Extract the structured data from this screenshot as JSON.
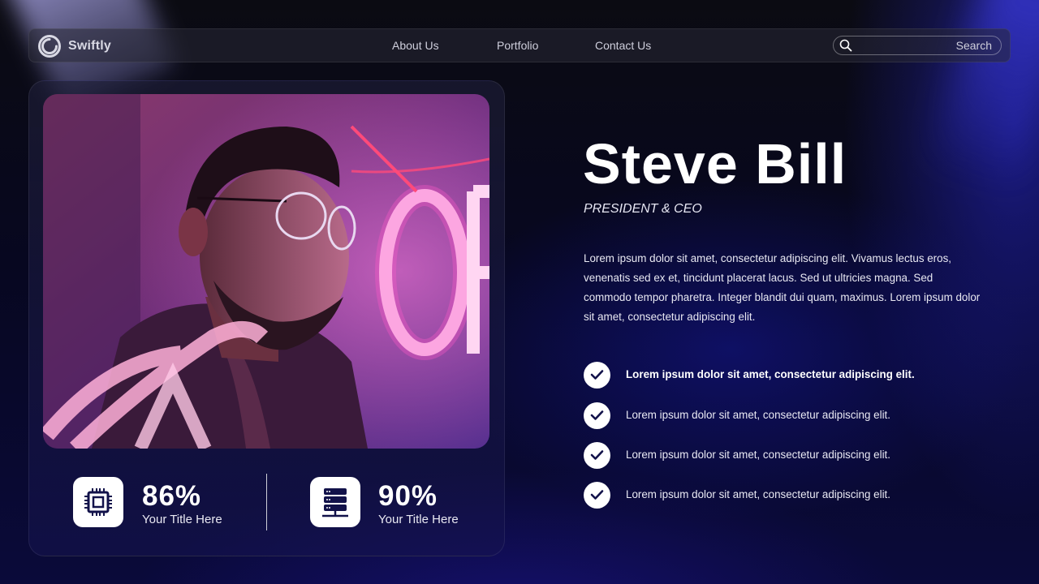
{
  "nav": {
    "brand": "Swiftly",
    "links": [
      "About Us",
      "Portfolio",
      "Contact Us"
    ],
    "search_label": "Search"
  },
  "profile": {
    "name": "Steve Bill",
    "role": "PRESIDENT & CEO",
    "bio": "Lorem ipsum dolor sit amet, consectetur adipiscing elit. Vivamus lectus eros, venenatis sed ex et, tincidunt placerat lacus. Sed ut ultricies magna. Sed commodo tempor pharetra. Integer blandit dui quam, maximus. Lorem ipsum dolor sit amet, consectetur adipiscing elit."
  },
  "stats": [
    {
      "value": "86%",
      "label": "Your Title Here",
      "icon": "cpu-chip-icon"
    },
    {
      "value": "90%",
      "label": "Your Title Here",
      "icon": "server-icon"
    }
  ],
  "checklist": [
    {
      "text": "Lorem ipsum dolor sit amet, consectetur adipiscing elit.",
      "bold": true
    },
    {
      "text": "Lorem ipsum dolor sit amet, consectetur adipiscing elit.",
      "bold": false
    },
    {
      "text": "Lorem ipsum dolor sit amet, consectetur adipiscing elit.",
      "bold": false
    },
    {
      "text": "Lorem ipsum dolor sit amet, consectetur adipiscing elit.",
      "bold": false
    }
  ],
  "colors": {
    "accent": "#1a1aa0",
    "background": "#07071a",
    "card": "#1c1a4a",
    "text": "#ffffff"
  }
}
